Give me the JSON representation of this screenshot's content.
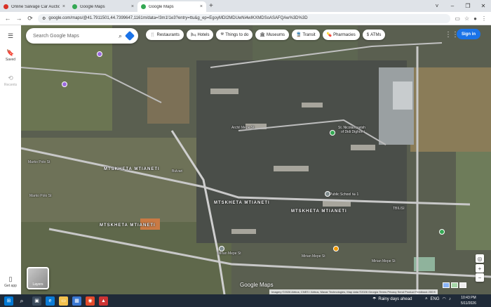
{
  "browser": {
    "tabs": [
      {
        "title": "Online Salvage Car Auctions ·",
        "icon_color": "#d93025",
        "active": false
      },
      {
        "title": "Google Maps",
        "icon_color": "#34a853",
        "active": false
      },
      {
        "title": "Google Maps",
        "icon_color": "#34a853",
        "active": true
      }
    ],
    "close_glyph": "×",
    "new_tab_glyph": "+",
    "window_controls": [
      "˅",
      "–",
      "❐",
      "✕"
    ],
    "url": "google.com/maps/@41.7911501,44.7399647,1161m/data=!3m1!1e3?entry=ttu&g_ep=EgoyMDI2MDUwNi4wIKXMDSoASAFQAw%3D%3D"
  },
  "rail": {
    "menu_icon": "menu-icon",
    "saved_label": "Saved",
    "recents_label": "Recents",
    "get_app_label": "Get app"
  },
  "search": {
    "placeholder": "Search Google Maps"
  },
  "chips": [
    {
      "label": "Restaurants",
      "icon": "🍴"
    },
    {
      "label": "Hotels",
      "icon": "🛏"
    },
    {
      "label": "Things to do",
      "icon": "⛯"
    },
    {
      "label": "Museums",
      "icon": "🏛"
    },
    {
      "label": "Transit",
      "icon": "🚆"
    },
    {
      "label": "Pharmacies",
      "icon": "💊"
    },
    {
      "label": "ATMs",
      "icon": "$"
    }
  ],
  "signin_label": "Sign in",
  "map_labels": {
    "mtskheta_1": "MTSKHETA MTIANETI",
    "mtskheta_2": "MTSKHETA MTIANETI",
    "mtskheta_3": "MTSKHETA MTIANETI",
    "mtskheta_4": "MTSKHETA MTIANETI",
    "marko_polo_1": "Marko Polo St",
    "marko_polo_2": "Marko Polo St",
    "mirian_mepe_1": "Mirian Mepe St",
    "mirian_mepe_2": "Mirian Mepe St",
    "mirian_mepe_3": "Mirian Mepe St",
    "archil_mepe": "Archil Mepe St",
    "nicolas": "St. Nicolas parish",
    "nicolas2": "of Didi Dighomi",
    "public_school": "Public School № 1",
    "bulvari": "Bulvari",
    "tbilisi": "TBILISI",
    "layers": "Layers",
    "google_maps": "Google Maps"
  },
  "attribution": "Imagery ©2026 Airbus, CNES / Airbus, Maxar Technologies, Map data ©2026   Georgia   Terms   Privacy   Send Product Feedback   200 ft",
  "taskbar": {
    "weather": "Rainy days ahead",
    "lang": "ENG",
    "time": "10:43 PM",
    "date": "5/11/2026"
  }
}
